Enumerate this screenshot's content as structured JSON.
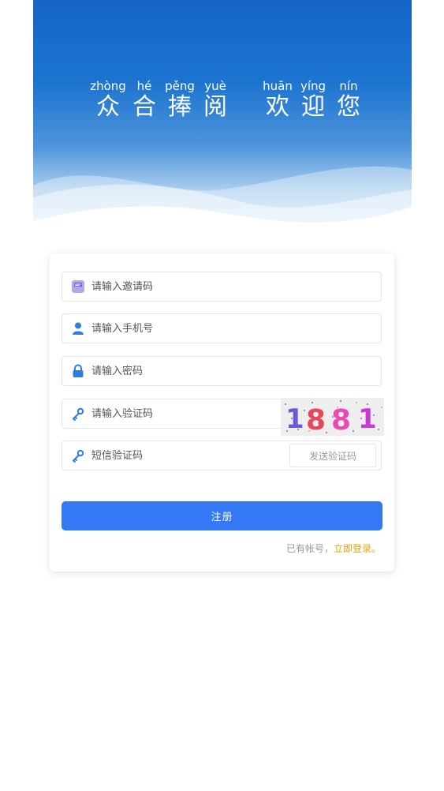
{
  "hero": {
    "slogan": [
      {
        "pinyin": "zhòng",
        "char": "众"
      },
      {
        "pinyin": "hé",
        "char": "合"
      },
      {
        "pinyin": "pěng",
        "char": "捧"
      },
      {
        "pinyin": "yuè",
        "char": "阅"
      },
      {
        "pinyin": "huān",
        "char": "欢"
      },
      {
        "pinyin": "yíng",
        "char": "迎"
      },
      {
        "pinyin": "nín",
        "char": "您"
      }
    ]
  },
  "form": {
    "invite_placeholder": "请输入邀请码",
    "phone_placeholder": "请输入手机号",
    "password_placeholder": "请输入密码",
    "captcha_placeholder": "请输入验证码",
    "captcha_text": "1881",
    "sms_placeholder": "短信验证码",
    "sms_button": "发送验证码",
    "submit_label": "注册",
    "login_prompt": "已有帐号，",
    "login_link": "立即登录。"
  },
  "icons": {
    "invite": "invite-card-icon",
    "phone": "user-icon",
    "password": "lock-icon",
    "captcha": "key-icon",
    "sms": "key-icon"
  },
  "colors": {
    "primary": "#3478f6",
    "link": "#e9a30a",
    "hero_top": "#1565c7"
  }
}
